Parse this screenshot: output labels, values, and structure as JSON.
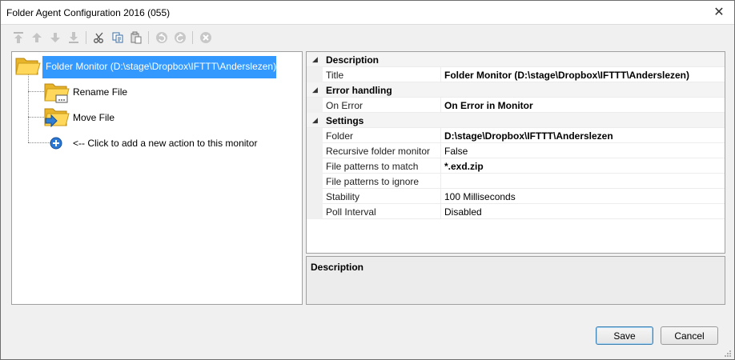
{
  "window": {
    "title": "Folder Agent Configuration 2016 (055)",
    "close_glyph": "✕"
  },
  "toolbar": {
    "buttons": [
      {
        "icon": "move-to-top-icon"
      },
      {
        "icon": "move-up-icon"
      },
      {
        "icon": "move-down-icon"
      },
      {
        "icon": "move-to-bottom-icon"
      },
      {
        "icon": "cut-icon"
      },
      {
        "icon": "copy-icon"
      },
      {
        "icon": "paste-icon"
      },
      {
        "icon": "undo-icon"
      },
      {
        "icon": "redo-icon"
      },
      {
        "icon": "delete-icon"
      }
    ]
  },
  "tree": {
    "root": {
      "label": "Folder Monitor (D:\\stage\\Dropbox\\IFTTT\\Anderslezen)",
      "icon": "folder-open-icon"
    },
    "children": [
      {
        "label": "Rename File",
        "icon": "folder-rename-icon"
      },
      {
        "label": "Move File",
        "icon": "folder-move-icon"
      }
    ],
    "add_hint": "<-- Click to add a new action to this monitor"
  },
  "properties": {
    "description": {
      "category": "Description",
      "rows": [
        {
          "name": "Title",
          "value": "Folder Monitor (D:\\stage\\Dropbox\\IFTTT\\Anderslezen)"
        }
      ]
    },
    "error_handling": {
      "category": "Error handling",
      "rows": [
        {
          "name": "On Error",
          "value": "On Error in Monitor"
        }
      ]
    },
    "settings": {
      "category": "Settings",
      "rows": [
        {
          "name": "Folder",
          "value": "D:\\stage\\Dropbox\\IFTTT\\Anderslezen"
        },
        {
          "name": "Recursive folder monitor",
          "value": "False"
        },
        {
          "name": "File patterns to match",
          "value": "*.exd.zip"
        },
        {
          "name": "File patterns to ignore",
          "value": ""
        },
        {
          "name": "Stability",
          "value": "100 Milliseconds"
        },
        {
          "name": "Poll Interval",
          "value": "Disabled"
        }
      ]
    }
  },
  "description_panel": {
    "title": "Description"
  },
  "buttons": {
    "save": "Save",
    "cancel": "Cancel"
  },
  "colors": {
    "selection": "#3399ff",
    "accent_blue": "#1e73c8"
  }
}
